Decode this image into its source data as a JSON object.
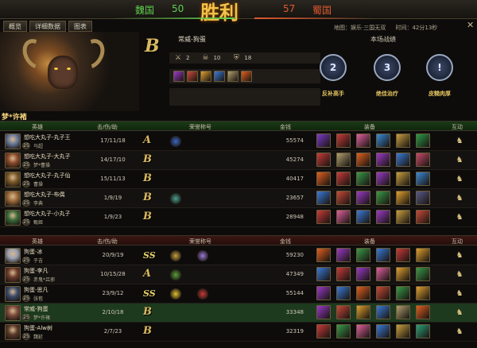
{
  "top": {
    "left_team": "魏国",
    "left_score": "50",
    "result": "胜利",
    "right_score": "57",
    "right_team": "蜀国"
  },
  "tabs": [
    "概览",
    "详细数据",
    "图表"
  ],
  "meta": {
    "map": "地图：娱乐·三国无双",
    "time": "时间：42分13秒"
  },
  "close_icon": "close-icon",
  "player": {
    "rank": "B",
    "title": "常威-狗蛋",
    "kills_icon": "swords-icon",
    "kills": "2",
    "deaths_icon": "skull-icon",
    "deaths": "10",
    "assists_icon": "shield-icon",
    "assists": "18",
    "items": [
      "#9a3ac8",
      "#c84a3a",
      "#e0a030",
      "#3a7ad8",
      "#b0a070",
      "#e06020"
    ]
  },
  "performance": {
    "title": "本场战绩",
    "badges": [
      {
        "num": "2",
        "label": "反补高手"
      },
      {
        "num": "3",
        "label": "绝佳治疗"
      },
      {
        "num": "!",
        "label": "皮糙肉厚"
      }
    ]
  },
  "team_label": "梦*许褚",
  "headers": {
    "hero": "英雄",
    "kda": "击/伤/助",
    "honor": "荣誉称号",
    "gold": "金钱",
    "equip": "装备",
    "interact": "互动"
  },
  "team1": [
    {
      "name": "想吃大丸子-丸子王",
      "level": "25",
      "hero": "马超",
      "kda": "17/11/18",
      "rank": "A",
      "gold": "55574",
      "avatar": "#6a7a9a",
      "honors": [
        "#3a6ac8"
      ],
      "equip": [
        "#7a3ac8",
        "#c83a3a",
        "#e060a0",
        "#3a8ad8",
        "#c8a040",
        "#2a9a4a"
      ]
    },
    {
      "name": "想吃大丸子-大丸子",
      "level": "25",
      "hero": "梦*曹操",
      "kda": "14/17/10",
      "rank": "B",
      "gold": "45274",
      "avatar": "#8a4a2a",
      "honors": [],
      "equip": [
        "#c83a3a",
        "#b0a070",
        "#e06020",
        "#9a3ac8",
        "#3a7ad8",
        "#c84a6a"
      ]
    },
    {
      "name": "想吃大丸子-丸子仙",
      "level": "25",
      "hero": "曹操",
      "kda": "15/11/13",
      "rank": "B",
      "gold": "40417",
      "avatar": "#7a5a2a",
      "honors": [],
      "equip": [
        "#e06020",
        "#c83a3a",
        "#3a9a4a",
        "#9a3ac8",
        "#c8a040",
        "#3a8ad8"
      ]
    },
    {
      "name": "想吃大丸子-布偶",
      "level": "25",
      "hero": "李典",
      "kda": "1/9/19",
      "rank": "B",
      "gold": "23657",
      "avatar": "#9a6a3a",
      "honors": [
        "#4aa090"
      ],
      "equip": [
        "#3a7ad8",
        "#c84a3a",
        "#9a3ac8",
        "#3a9a4a",
        "#e0a030",
        "#5a5a8a"
      ]
    },
    {
      "name": "想吃大丸子-小丸子",
      "level": "25",
      "hero": "甄姬",
      "kda": "1/9/23",
      "rank": "B",
      "gold": "28948",
      "avatar": "#3a6a3a",
      "honors": [],
      "equip": [
        "#c83a3a",
        "#e060a0",
        "#3a7ad8",
        "#9a3ac8",
        "#c8a040",
        "#c84a3a"
      ]
    }
  ],
  "team2": [
    {
      "name": "狗蛋-冰",
      "level": "25",
      "hero": "于吉",
      "kda": "20/9/19",
      "rank": "SS",
      "gold": "59230",
      "avatar": "#9aa0b0",
      "honors": [
        "#c8a040",
        "#9a7ad8"
      ],
      "equip": [
        "#e06020",
        "#9a3ac8",
        "#3a9a4a",
        "#3a7ad8",
        "#c83a3a",
        "#e0a030"
      ]
    },
    {
      "name": "狗蛋-李凡",
      "level": "25",
      "hero": "赤鬼*吕邪",
      "kda": "10/15/28",
      "rank": "A",
      "gold": "47349",
      "avatar": "#6a3a2a",
      "honors": [
        "#5aa03a"
      ],
      "equip": [
        "#3a7ad8",
        "#c83a3a",
        "#9a3ac8",
        "#e060a0",
        "#e0a030",
        "#3a9a4a"
      ]
    },
    {
      "name": "狗蛋-思凡",
      "level": "25",
      "hero": "张苞",
      "kda": "23/9/12",
      "rank": "SS",
      "gold": "55144",
      "avatar": "#3a4a6a",
      "honors": [
        "#e0c030",
        "#c83a3a"
      ],
      "equip": [
        "#9a3ac8",
        "#3a7ad8",
        "#e06020",
        "#c84a3a",
        "#3a9a4a",
        "#e0a030"
      ]
    },
    {
      "name": "常威-狗蛋",
      "level": "25",
      "hero": "梦*许褚",
      "kda": "2/10/18",
      "rank": "B",
      "gold": "33348",
      "avatar": "#7a4a3a",
      "honors": [],
      "equip": [
        "#9a3ac8",
        "#c84a3a",
        "#e0a030",
        "#3a7ad8",
        "#b0a070",
        "#e06020"
      ]
    },
    {
      "name": "狗蛋-Alw树",
      "level": "25",
      "hero": "魏延",
      "kda": "2/7/23",
      "rank": "B",
      "gold": "32319",
      "avatar": "#5a3a2a",
      "honors": [],
      "equip": [
        "#c83a3a",
        "#3a9a4a",
        "#e060a0",
        "#3a7ad8",
        "#c8a040",
        "#2aa07a"
      ]
    }
  ]
}
